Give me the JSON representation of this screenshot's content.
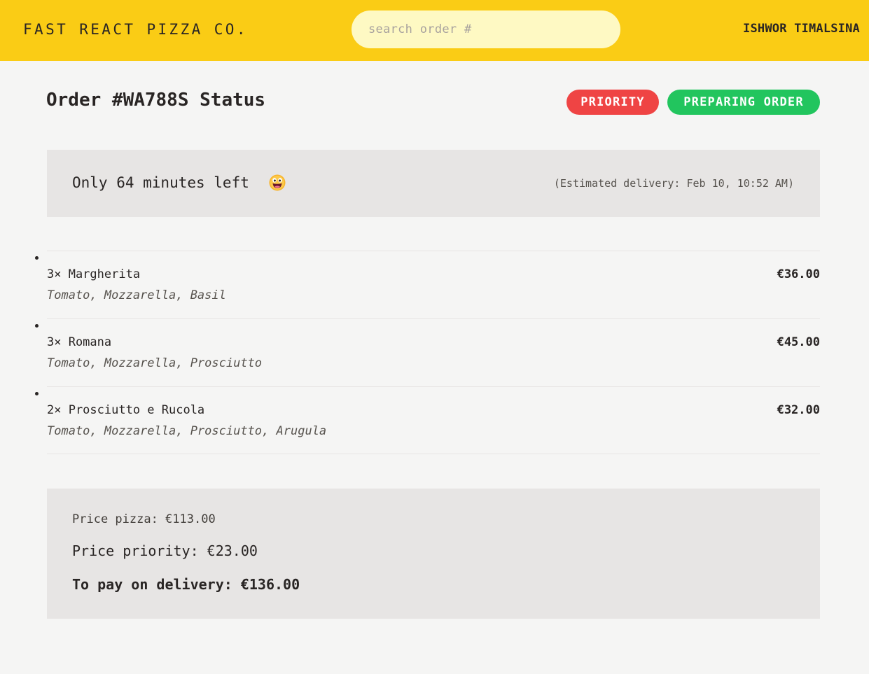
{
  "header": {
    "brand": "FAST REACT PIZZA CO.",
    "search_placeholder": "search order #",
    "username": "ISHWOR TIMALSINA"
  },
  "order": {
    "title": "Order #WA788S Status",
    "badges": {
      "priority": "PRIORITY",
      "status": "PREPARING ORDER"
    },
    "countdown": "Only 64 minutes left",
    "eta": "(Estimated delivery: Feb 10, 10:52 AM)",
    "items": [
      {
        "name": "3× Margherita",
        "ingredients": "Tomato, Mozzarella, Basil",
        "price": "€36.00"
      },
      {
        "name": "3× Romana",
        "ingredients": "Tomato, Mozzarella, Prosciutto",
        "price": "€45.00"
      },
      {
        "name": "2× Prosciutto e Rucola",
        "ingredients": "Tomato, Mozzarella, Prosciutto, Arugula",
        "price": "€32.00"
      }
    ],
    "summary": {
      "price_pizza": "Price pizza: €113.00",
      "price_priority": "Price priority: €23.00",
      "to_pay": "To pay on delivery: €136.00"
    }
  },
  "colors": {
    "header_bg": "#facc15",
    "search_bg": "#fef9c3",
    "priority_badge": "#ef4444",
    "status_badge": "#22c55e",
    "panel_bg": "#e7e5e4",
    "page_bg": "#f5f5f4"
  }
}
